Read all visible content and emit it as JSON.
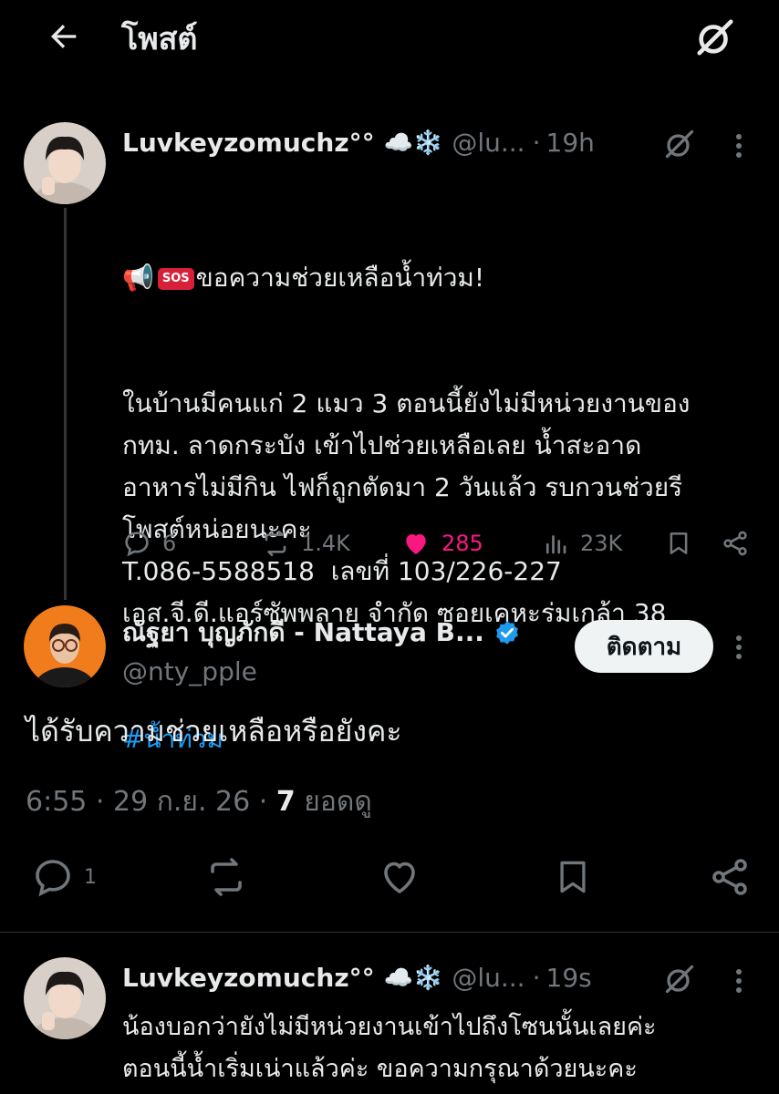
{
  "header": {
    "title": "โพสต์",
    "back_icon": "back-arrow-icon",
    "grok_icon": "grok-icon"
  },
  "tweet1": {
    "display_name": "Luvkeyzomuchz°°",
    "emojis": "☁️❄️",
    "handle": "@lu...",
    "time": "19h",
    "line1_suffix": "ขอความช่วยเหลือน้ำท่วม!",
    "megaphone": "📢",
    "sos": "SOS",
    "body": "ในบ้านมีคนแก่ 2 แมว 3 ตอนนี้ยังไม่มีหน่วยงานของ\nกทม. ลาดกระบัง เข้าไปช่วยเหลือเลย น้ำสะอาด\nอาหารไม่มีกิน ไฟก็ถูกตัดมา 2 วันแล้ว รบกวนช่วยรี\nโพสต์หน่อยนะคะ\nT.086-5588518  เลขที่ 103/226-227\nเอส.จี.ดี.แอร์ซัพพลาย จำกัด ซอยเคหะร่มเกล้า 38",
    "hashtag": "#น้ำท่วม",
    "replies": "6",
    "reposts": "1.4K",
    "likes": "285",
    "views": "23K"
  },
  "reply": {
    "display_name": "ณัฐยา บุญภักดี - Nattaya B...",
    "handle": "@nty_pple",
    "follow_label": "ติดตาม",
    "text": "ได้รับความช่วยเหลือหรือยังคะ",
    "meta_time": "6:55",
    "meta_date": "29 ก.ย. 26",
    "meta_views_count": "7",
    "meta_views_label": "ยอดดู",
    "replies": "1"
  },
  "tweet3": {
    "display_name": "Luvkeyzomuchz°°",
    "emojis": "☁️❄️",
    "handle": "@lu...",
    "time": "19s",
    "body": "น้องบอกว่ายังไม่มีหน่วยงานเข้าไปถึงโซนนั้นเลยค่ะ\nตอนนี้น้ำเริ่มเน่าแล้วค่ะ ขอความกรุณาด้วยนะคะ"
  },
  "colors": {
    "background": "#000000",
    "text": "#e7e9ea",
    "muted": "#71767b",
    "link": "#1d9bf0",
    "like": "#f91880",
    "verified": "#1d9bf0"
  }
}
